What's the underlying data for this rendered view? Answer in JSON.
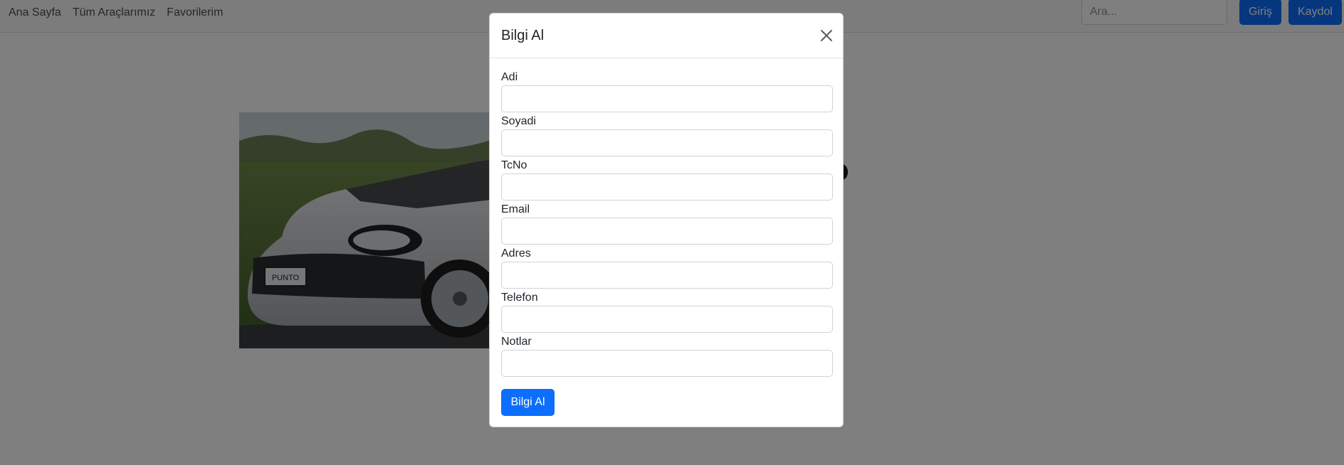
{
  "navbar": {
    "links": [
      "Ana Sayfa",
      "Tüm Araçlarımız",
      "Favorilerim"
    ],
    "search_placeholder": "Ara...",
    "login_label": "Giriş",
    "register_label": "Kaydol"
  },
  "hero": {
    "car_badge_text": "PUNTO"
  },
  "modal": {
    "title": "Bilgi Al",
    "fields": [
      {
        "label": "Adi",
        "value": ""
      },
      {
        "label": "Soyadi",
        "value": ""
      },
      {
        "label": "TcNo",
        "value": ""
      },
      {
        "label": "Email",
        "value": ""
      },
      {
        "label": "Adres",
        "value": ""
      },
      {
        "label": "Telefon",
        "value": ""
      },
      {
        "label": "Notlar",
        "value": ""
      }
    ],
    "submit_label": "Bilgi Al"
  },
  "colors": {
    "primary": "#0d6efd",
    "backdrop": "rgba(0,0,0,0.5)"
  },
  "icons": {
    "close": "close-icon"
  }
}
